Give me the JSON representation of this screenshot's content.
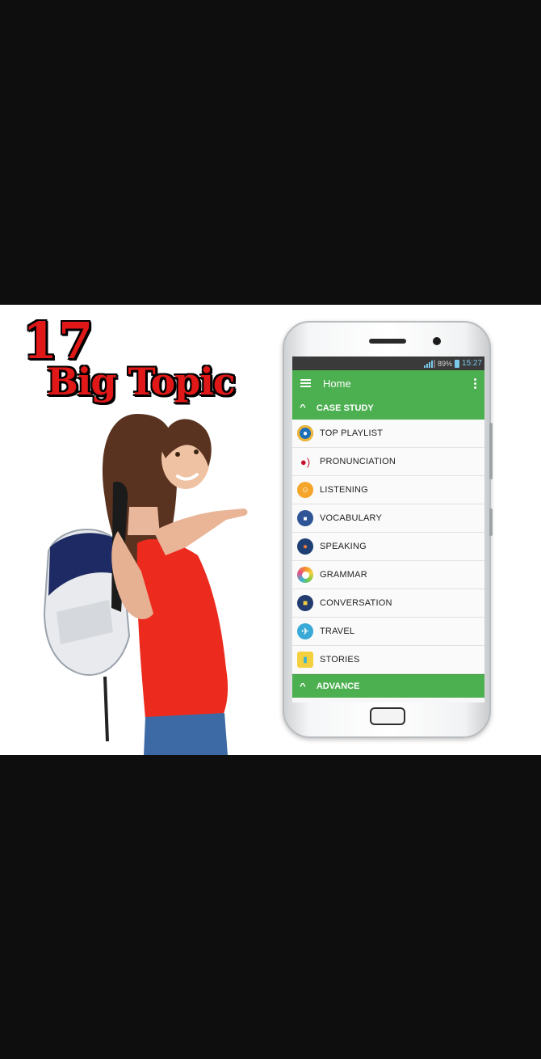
{
  "promo": {
    "headline_number": "17",
    "headline_text": "Big Topic"
  },
  "status_bar": {
    "battery": "89%",
    "time": "15:27"
  },
  "app_bar": {
    "title": "Home"
  },
  "sections": [
    {
      "title": "CASE STUDY",
      "expanded": true
    },
    {
      "title": "ADVANCE",
      "expanded": true
    }
  ],
  "menu_items": [
    {
      "label": "TOP PLAYLIST",
      "icon": "playlist-icon",
      "color": "#1d6fb8"
    },
    {
      "label": "PRONUNCIATION",
      "icon": "pronunciation-icon",
      "color": "#c8102e"
    },
    {
      "label": "LISTENING",
      "icon": "headphones-icon",
      "color": "#f4a52a"
    },
    {
      "label": "VOCABULARY",
      "icon": "vocabulary-blocks-icon",
      "color": "#2f5597"
    },
    {
      "label": "SPEAKING",
      "icon": "speaking-bubbles-icon",
      "color": "#1e3f73"
    },
    {
      "label": "GRAMMAR",
      "icon": "grammar-ring-icon",
      "color": "#f58f2b"
    },
    {
      "label": "CONVERSATION",
      "icon": "conversation-icon",
      "color": "#233c70"
    },
    {
      "label": "TRAVEL",
      "icon": "airplane-icon",
      "color": "#39a9d8"
    },
    {
      "label": "STORIES",
      "icon": "book-icon",
      "color": "#3bb3d4"
    }
  ],
  "colors": {
    "accent_green": "#4caf50",
    "headline_red": "#e01818",
    "letterbox": "#0e0e0e"
  }
}
